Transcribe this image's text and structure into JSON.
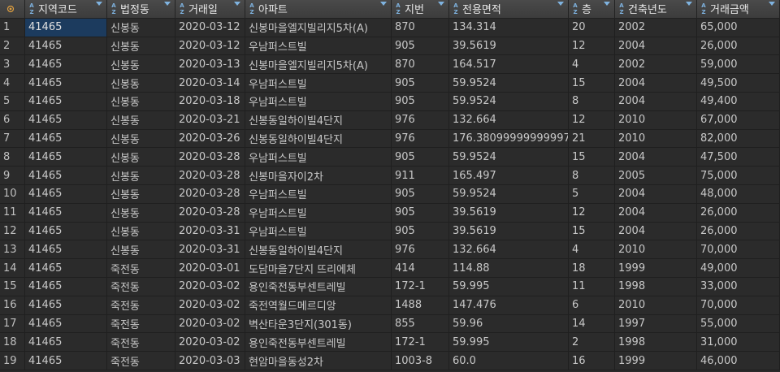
{
  "columns": [
    {
      "label": "지역코드"
    },
    {
      "label": "법정동"
    },
    {
      "label": "거래일"
    },
    {
      "label": "아파트"
    },
    {
      "label": "지번"
    },
    {
      "label": "전용면적"
    },
    {
      "label": "층"
    },
    {
      "label": "건축년도"
    },
    {
      "label": "거래금액"
    }
  ],
  "sort_icon": "az-sort-icon",
  "filter_icon": "filter-dropdown-icon",
  "selected_color": "#1c3b5e",
  "rows": [
    {
      "n": "1",
      "c": [
        "41465",
        "신봉동",
        "2020-03-12",
        "신봉마을엘지빌리지5차(A)",
        "870",
        "134.314",
        "20",
        "2002",
        "65,000"
      ]
    },
    {
      "n": "2",
      "c": [
        "41465",
        "신봉동",
        "2020-03-12",
        "우남퍼스트빌",
        "905",
        "39.5619",
        "12",
        "2004",
        "26,000"
      ]
    },
    {
      "n": "3",
      "c": [
        "41465",
        "신봉동",
        "2020-03-13",
        "신봉마을엘지빌리지5차(A)",
        "870",
        "164.517",
        "4",
        "2002",
        "59,000"
      ]
    },
    {
      "n": "4",
      "c": [
        "41465",
        "신봉동",
        "2020-03-14",
        "우남퍼스트빌",
        "905",
        "59.9524",
        "15",
        "2004",
        "49,500"
      ]
    },
    {
      "n": "5",
      "c": [
        "41465",
        "신봉동",
        "2020-03-18",
        "우남퍼스트빌",
        "905",
        "59.9524",
        "8",
        "2004",
        "49,400"
      ]
    },
    {
      "n": "6",
      "c": [
        "41465",
        "신봉동",
        "2020-03-21",
        "신봉동일하이빌4단지",
        "976",
        "132.664",
        "12",
        "2010",
        "67,000"
      ]
    },
    {
      "n": "7",
      "c": [
        "41465",
        "신봉동",
        "2020-03-26",
        "신봉동일하이빌4단지",
        "976",
        "176.38099999999997",
        "21",
        "2010",
        "82,000"
      ]
    },
    {
      "n": "8",
      "c": [
        "41465",
        "신봉동",
        "2020-03-28",
        "우남퍼스트빌",
        "905",
        "59.9524",
        "15",
        "2004",
        "47,500"
      ]
    },
    {
      "n": "9",
      "c": [
        "41465",
        "신봉동",
        "2020-03-28",
        "신봉마을자이2차",
        "911",
        "165.497",
        "8",
        "2005",
        "75,000"
      ]
    },
    {
      "n": "10",
      "c": [
        "41465",
        "신봉동",
        "2020-03-28",
        "우남퍼스트빌",
        "905",
        "59.9524",
        "5",
        "2004",
        "48,000"
      ]
    },
    {
      "n": "11",
      "c": [
        "41465",
        "신봉동",
        "2020-03-28",
        "우남퍼스트빌",
        "905",
        "39.5619",
        "12",
        "2004",
        "26,000"
      ]
    },
    {
      "n": "12",
      "c": [
        "41465",
        "신봉동",
        "2020-03-31",
        "우남퍼스트빌",
        "905",
        "39.5619",
        "15",
        "2004",
        "26,000"
      ]
    },
    {
      "n": "13",
      "c": [
        "41465",
        "신봉동",
        "2020-03-31",
        "신봉동일하이빌4단지",
        "976",
        "132.664",
        "4",
        "2010",
        "70,000"
      ]
    },
    {
      "n": "14",
      "c": [
        "41465",
        "죽전동",
        "2020-03-01",
        "도담마을7단지 뜨리에체",
        "414",
        "114.88",
        "18",
        "1999",
        "49,000"
      ]
    },
    {
      "n": "15",
      "c": [
        "41465",
        "죽전동",
        "2020-03-02",
        "용인죽전동부센트레빌",
        "172-1",
        "59.995",
        "11",
        "1998",
        "33,000"
      ]
    },
    {
      "n": "16",
      "c": [
        "41465",
        "죽전동",
        "2020-03-02",
        "죽전역월드메르디앙",
        "1488",
        "147.476",
        "6",
        "2010",
        "70,000"
      ]
    },
    {
      "n": "17",
      "c": [
        "41465",
        "죽전동",
        "2020-03-02",
        "벽산타운3단지(301동)",
        "855",
        "59.96",
        "14",
        "1997",
        "55,000"
      ]
    },
    {
      "n": "18",
      "c": [
        "41465",
        "죽전동",
        "2020-03-02",
        "용인죽전동부센트레빌",
        "172-1",
        "59.995",
        "2",
        "1998",
        "31,000"
      ]
    },
    {
      "n": "19",
      "c": [
        "41465",
        "죽전동",
        "2020-03-03",
        "현암마을동성2차",
        "1003-8",
        "60.0",
        "16",
        "1999",
        "46,000"
      ]
    }
  ]
}
